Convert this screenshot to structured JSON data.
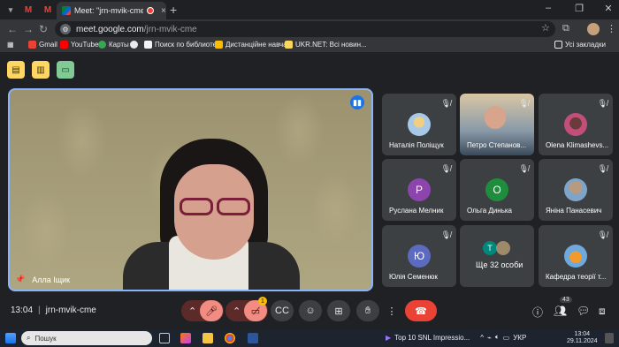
{
  "browser": {
    "tab_title": "Meet: \"jrn-mvik-cme\"",
    "tab_close": "×",
    "new_tab": "+",
    "url_host": "meet.google.com",
    "url_path": "/jrn-mvik-cme",
    "site_icon": "tune-icon",
    "mini_tab_1": "M",
    "mini_tab_2": "M"
  },
  "bookmarks": {
    "items": [
      "Gmail",
      "YouTube",
      "Карты",
      "",
      "Поиск по библиоте...",
      "Дистанційне навча...",
      "UKR.NET: Всі новин..."
    ],
    "all": "Усі закладки"
  },
  "meet": {
    "main_speaker": "Алла Іщик",
    "meeting_code": "jrn-mvik-cme",
    "time": "13:04",
    "people_count": "43",
    "camera_badge": "1",
    "participants": [
      {
        "name": "Наталія Поліщук",
        "avatar": ""
      },
      {
        "name": "Петро Степанов...",
        "avatar": ""
      },
      {
        "name": "Olena Klimashevs...",
        "avatar": ""
      },
      {
        "name": "Руслана Мелник",
        "avatar": "Р"
      },
      {
        "name": "Ольга Динька",
        "avatar": "О"
      },
      {
        "name": "Яніна Панасевич",
        "avatar": ""
      },
      {
        "name": "Юлія Семенюк",
        "avatar": "Ю"
      },
      {
        "name": "Ще 32 особи",
        "avatar": "Т"
      },
      {
        "name": "Кафедра теорії т...",
        "avatar": ""
      }
    ]
  },
  "taskbar": {
    "search": "Пошук",
    "media": "Top 10 SNL Impressio...",
    "lang": "УКР",
    "clock_time": "13:04",
    "clock_date": "29.11.2024"
  },
  "colors": {
    "accent": "#8ab4f8",
    "end_call": "#ea4335",
    "mic_off": "#f28b82"
  }
}
